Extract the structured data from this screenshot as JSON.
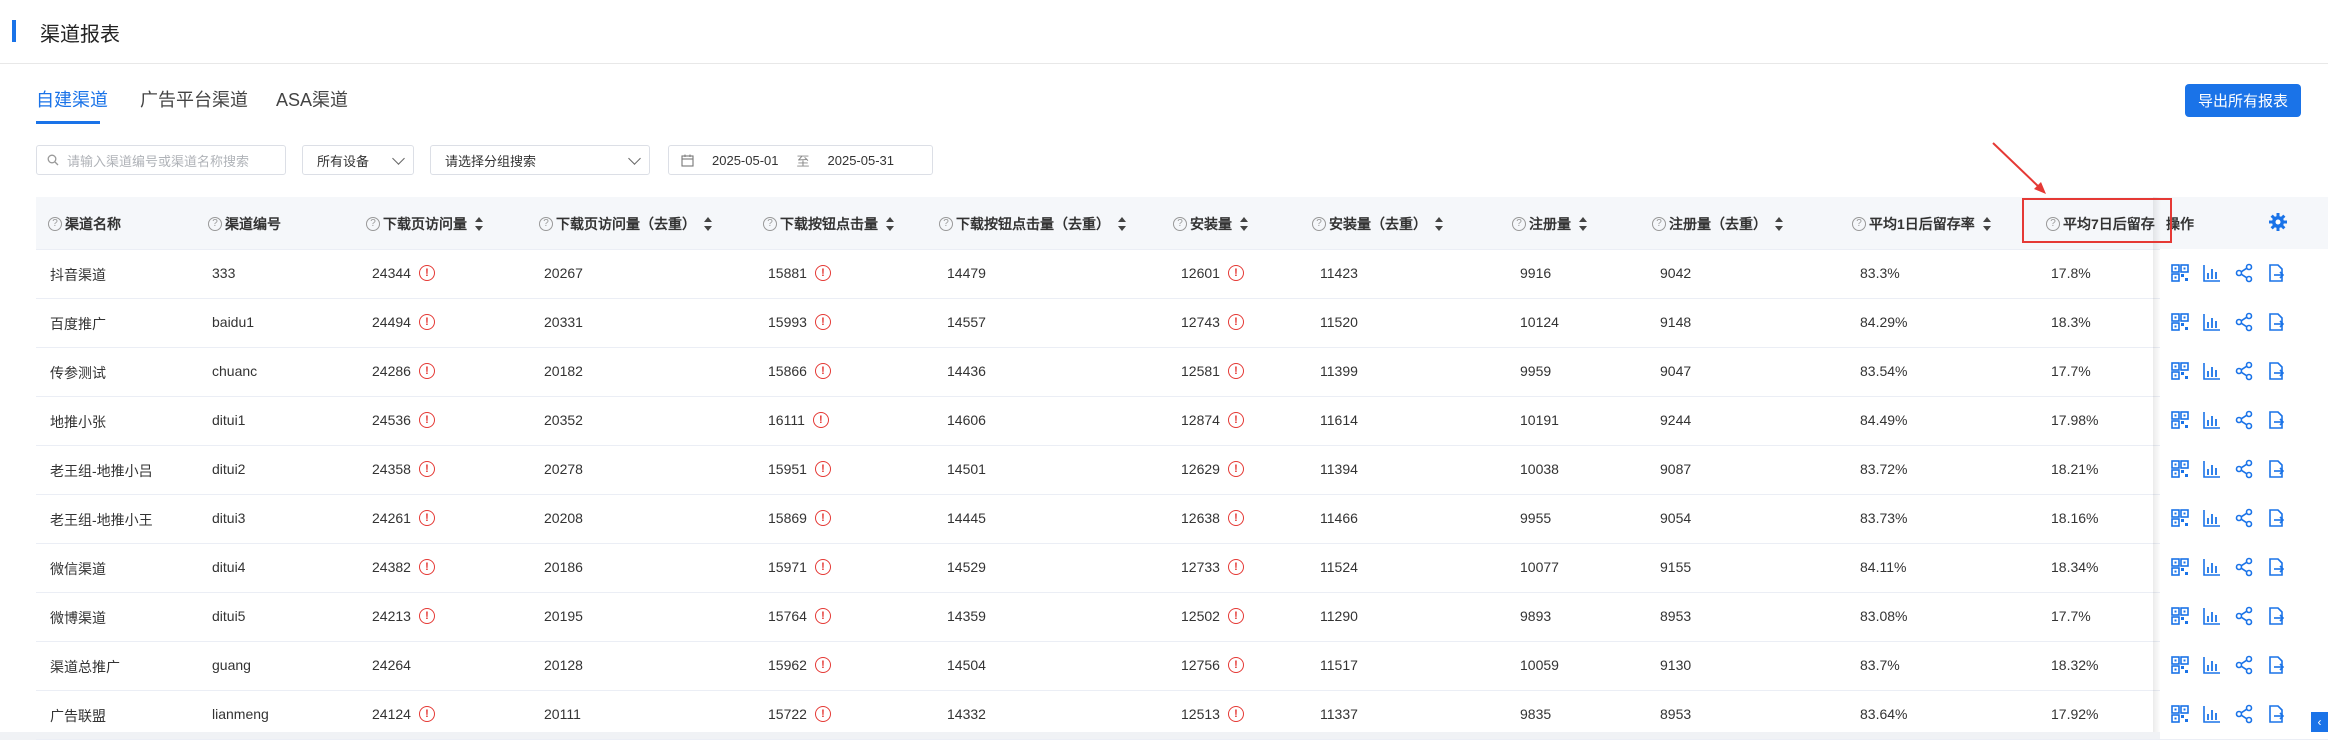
{
  "page_title": "渠道报表",
  "tabs": [
    {
      "label": "自建渠道",
      "active": true
    },
    {
      "label": "广告平台渠道",
      "active": false
    },
    {
      "label": "ASA渠道",
      "active": false
    }
  ],
  "export_button": "导出所有报表",
  "filters": {
    "search_placeholder": "请输入渠道编号或渠道名称搜索",
    "device_select": "所有设备",
    "group_placeholder": "请选择分组搜索",
    "date_start": "2025-05-01",
    "date_separator": "至",
    "date_end": "2025-05-31"
  },
  "table": {
    "columns": [
      {
        "label": "渠道名称",
        "help": true,
        "sortable": false
      },
      {
        "label": "渠道编号",
        "help": true,
        "sortable": false
      },
      {
        "label": "下载页访问量",
        "help": true,
        "sortable": true
      },
      {
        "label": "下载页访问量（去重）",
        "help": true,
        "sortable": true
      },
      {
        "label": "下载按钮点击量",
        "help": true,
        "sortable": true
      },
      {
        "label": "下载按钮点击量（去重）",
        "help": true,
        "sortable": true
      },
      {
        "label": "安装量",
        "help": true,
        "sortable": true
      },
      {
        "label": "安装量（去重）",
        "help": true,
        "sortable": true
      },
      {
        "label": "注册量",
        "help": true,
        "sortable": true
      },
      {
        "label": "注册量（去重）",
        "help": true,
        "sortable": true
      },
      {
        "label": "平均1日后留存率",
        "help": true,
        "sortable": true
      },
      {
        "label": "平均7日后留存",
        "help": true,
        "sortable": false
      }
    ],
    "ops_header": "操作",
    "warn_glyph": "!",
    "rows": [
      {
        "name": "抖音渠道",
        "code": "333",
        "visits": "24344",
        "visits_warn": true,
        "visits_uniq": "20267",
        "clicks": "15881",
        "clicks_warn": true,
        "clicks_uniq": "14479",
        "installs": "12601",
        "installs_warn": true,
        "installs_uniq": "11423",
        "regs": "9916",
        "regs_uniq": "9042",
        "ret1": "83.3%",
        "ret7": "17.8%"
      },
      {
        "name": "百度推广",
        "code": "baidu1",
        "visits": "24494",
        "visits_warn": true,
        "visits_uniq": "20331",
        "clicks": "15993",
        "clicks_warn": true,
        "clicks_uniq": "14557",
        "installs": "12743",
        "installs_warn": true,
        "installs_uniq": "11520",
        "regs": "10124",
        "regs_uniq": "9148",
        "ret1": "84.29%",
        "ret7": "18.3%"
      },
      {
        "name": "传参测试",
        "code": "chuanc",
        "visits": "24286",
        "visits_warn": true,
        "visits_uniq": "20182",
        "clicks": "15866",
        "clicks_warn": true,
        "clicks_uniq": "14436",
        "installs": "12581",
        "installs_warn": true,
        "installs_uniq": "11399",
        "regs": "9959",
        "regs_uniq": "9047",
        "ret1": "83.54%",
        "ret7": "17.7%"
      },
      {
        "name": "地推小张",
        "code": "ditui1",
        "visits": "24536",
        "visits_warn": true,
        "visits_uniq": "20352",
        "clicks": "16111",
        "clicks_warn": true,
        "clicks_uniq": "14606",
        "installs": "12874",
        "installs_warn": true,
        "installs_uniq": "11614",
        "regs": "10191",
        "regs_uniq": "9244",
        "ret1": "84.49%",
        "ret7": "17.98%"
      },
      {
        "name": "老王组-地推小吕",
        "code": "ditui2",
        "visits": "24358",
        "visits_warn": true,
        "visits_uniq": "20278",
        "clicks": "15951",
        "clicks_warn": true,
        "clicks_uniq": "14501",
        "installs": "12629",
        "installs_warn": true,
        "installs_uniq": "11394",
        "regs": "10038",
        "regs_uniq": "9087",
        "ret1": "83.72%",
        "ret7": "18.21%"
      },
      {
        "name": "老王组-地推小王",
        "code": "ditui3",
        "visits": "24261",
        "visits_warn": true,
        "visits_uniq": "20208",
        "clicks": "15869",
        "clicks_warn": true,
        "clicks_uniq": "14445",
        "installs": "12638",
        "installs_warn": true,
        "installs_uniq": "11466",
        "regs": "9955",
        "regs_uniq": "9054",
        "ret1": "83.73%",
        "ret7": "18.16%"
      },
      {
        "name": "微信渠道",
        "code": "ditui4",
        "visits": "24382",
        "visits_warn": true,
        "visits_uniq": "20186",
        "clicks": "15971",
        "clicks_warn": true,
        "clicks_uniq": "14529",
        "installs": "12733",
        "installs_warn": true,
        "installs_uniq": "11524",
        "regs": "10077",
        "regs_uniq": "9155",
        "ret1": "84.11%",
        "ret7": "18.34%"
      },
      {
        "name": "微博渠道",
        "code": "ditui5",
        "visits": "24213",
        "visits_warn": true,
        "visits_uniq": "20195",
        "clicks": "15764",
        "clicks_warn": true,
        "clicks_uniq": "14359",
        "installs": "12502",
        "installs_warn": true,
        "installs_uniq": "11290",
        "regs": "9893",
        "regs_uniq": "8953",
        "ret1": "83.08%",
        "ret7": "17.7%"
      },
      {
        "name": "渠道总推广",
        "code": "guang",
        "visits": "24264",
        "visits_warn": false,
        "visits_uniq": "20128",
        "clicks": "15962",
        "clicks_warn": true,
        "clicks_uniq": "14504",
        "installs": "12756",
        "installs_warn": true,
        "installs_uniq": "11517",
        "regs": "10059",
        "regs_uniq": "9130",
        "ret1": "83.7%",
        "ret7": "18.32%"
      },
      {
        "name": "广告联盟",
        "code": "lianmeng",
        "visits": "24124",
        "visits_warn": true,
        "visits_uniq": "20111",
        "clicks": "15722",
        "clicks_warn": true,
        "clicks_uniq": "14332",
        "installs": "12513",
        "installs_warn": true,
        "installs_uniq": "11337",
        "regs": "9835",
        "regs_uniq": "8953",
        "ret1": "83.64%",
        "ret7": "17.92%"
      }
    ],
    "row_actions": [
      "qrcode-icon",
      "chart-icon",
      "share-icon",
      "export-icon"
    ]
  },
  "colors": {
    "accent": "#1a73e8",
    "warn": "#e53935",
    "highlight": "#e53935"
  }
}
